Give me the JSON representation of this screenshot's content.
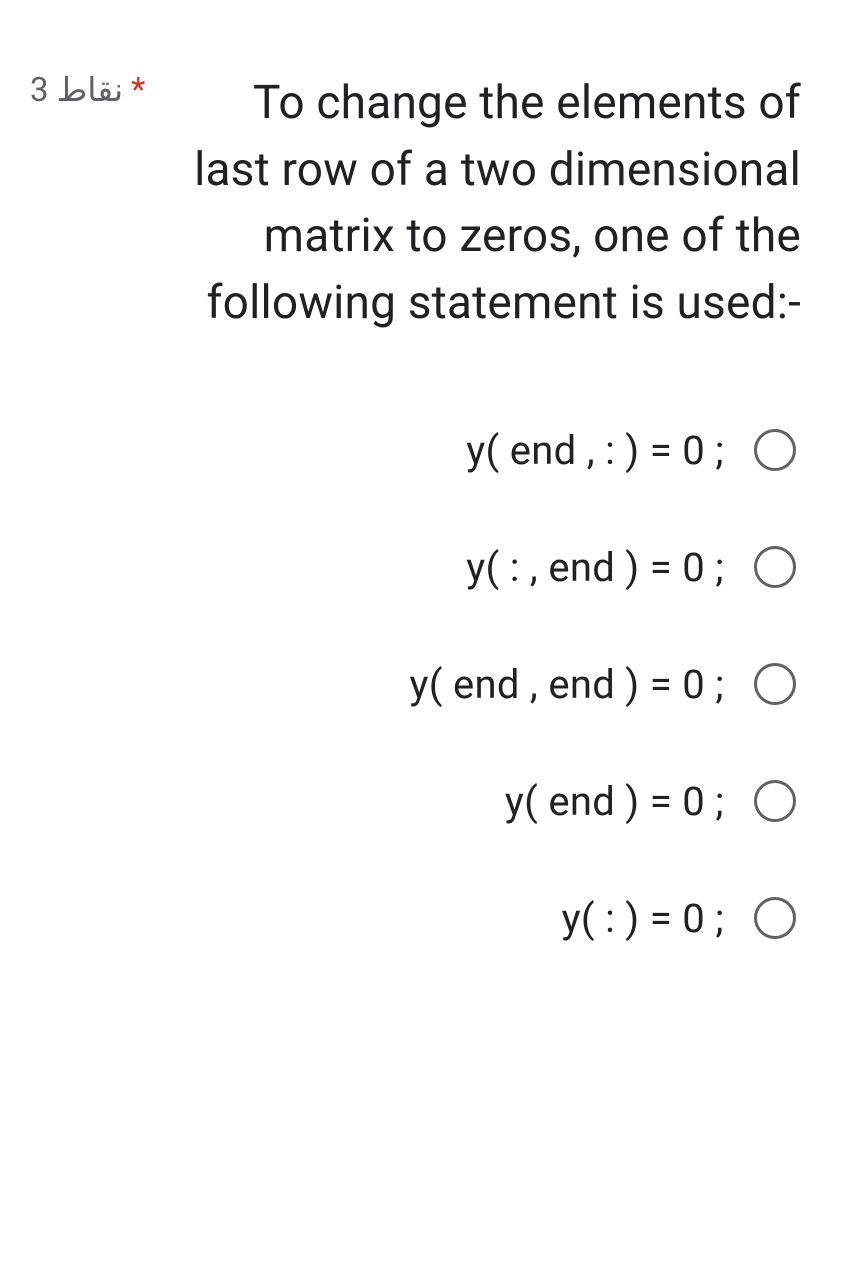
{
  "points_text": "3 نقاط",
  "required_marker": "*",
  "question_text": "To change the elements of last row of a two dimensional matrix to zeros, one of the following statement is used:-",
  "options": [
    {
      "label": "y( end , : ) = 0 ;"
    },
    {
      "label": "y( : , end ) = 0 ;"
    },
    {
      "label": "y( end , end ) = 0 ;"
    },
    {
      "label": "y( end ) = 0 ;"
    },
    {
      "label": "y( : ) = 0 ;"
    }
  ]
}
